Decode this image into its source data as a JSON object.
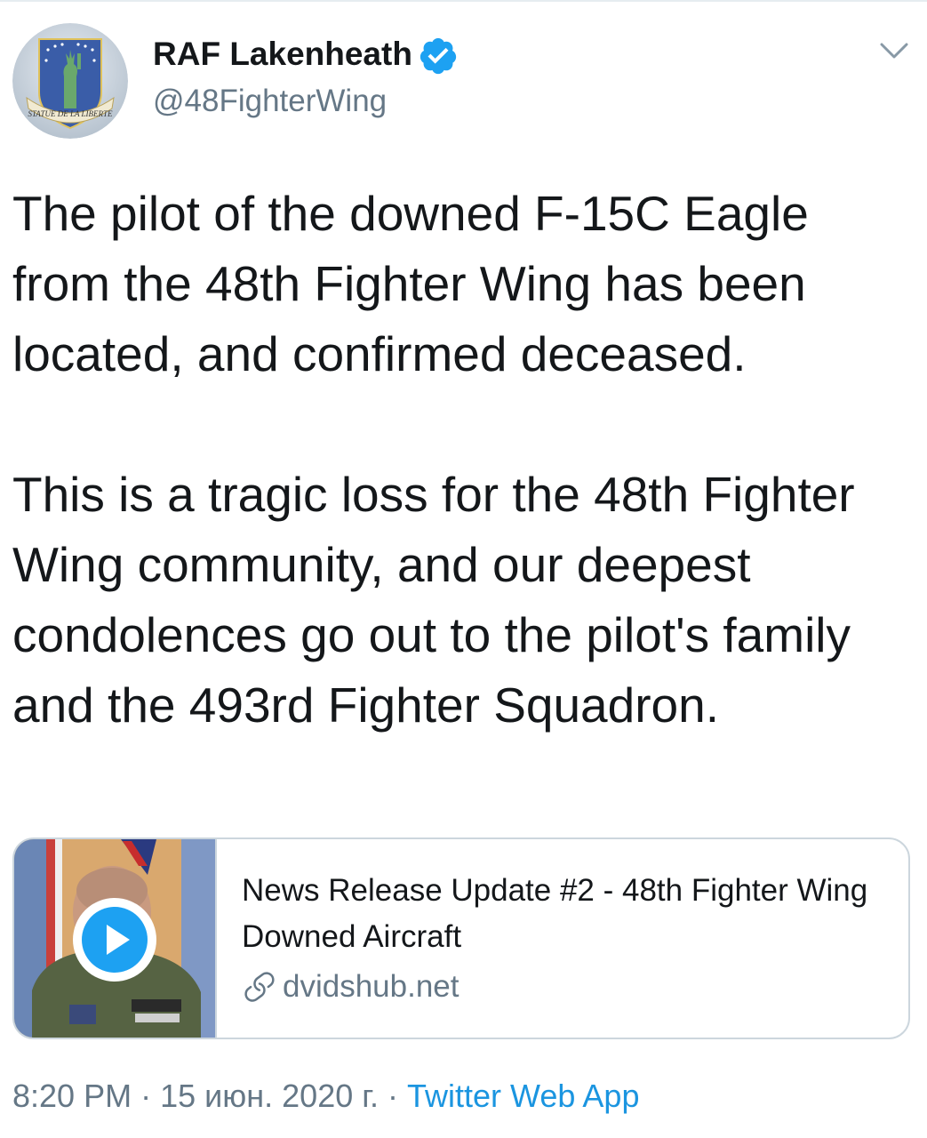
{
  "tweet": {
    "author": {
      "name": "RAF Lakenheath",
      "handle": "@48FighterWing",
      "verified": true,
      "avatar_text": "STATUE DE LA LIBERTE"
    },
    "text": [
      "The pilot of the downed F-15C Eagle from the 48th Fighter Wing has been located, and confirmed deceased.",
      "This is a tragic loss for the 48th Fighter Wing community, and our deepest condolences go out to the pilot's family and the 493rd Fighter Squadron."
    ],
    "card": {
      "title": "News Release Update #2 - 48th Fighter Wing Downed Aircraft",
      "domain": "dvidshub.net"
    },
    "meta": {
      "time": "8:20 PM",
      "date": "15 июн. 2020 г.",
      "separator": "·",
      "source": "Twitter Web App"
    }
  },
  "icons": {
    "verified": "verified-badge-icon",
    "caret": "chevron-down-icon",
    "play": "play-icon",
    "link": "link-icon"
  },
  "colors": {
    "text": "#14171a",
    "secondary": "#657786",
    "accent": "#1da1f2",
    "link": "#1b95e0",
    "border": "#ccd6dd"
  }
}
